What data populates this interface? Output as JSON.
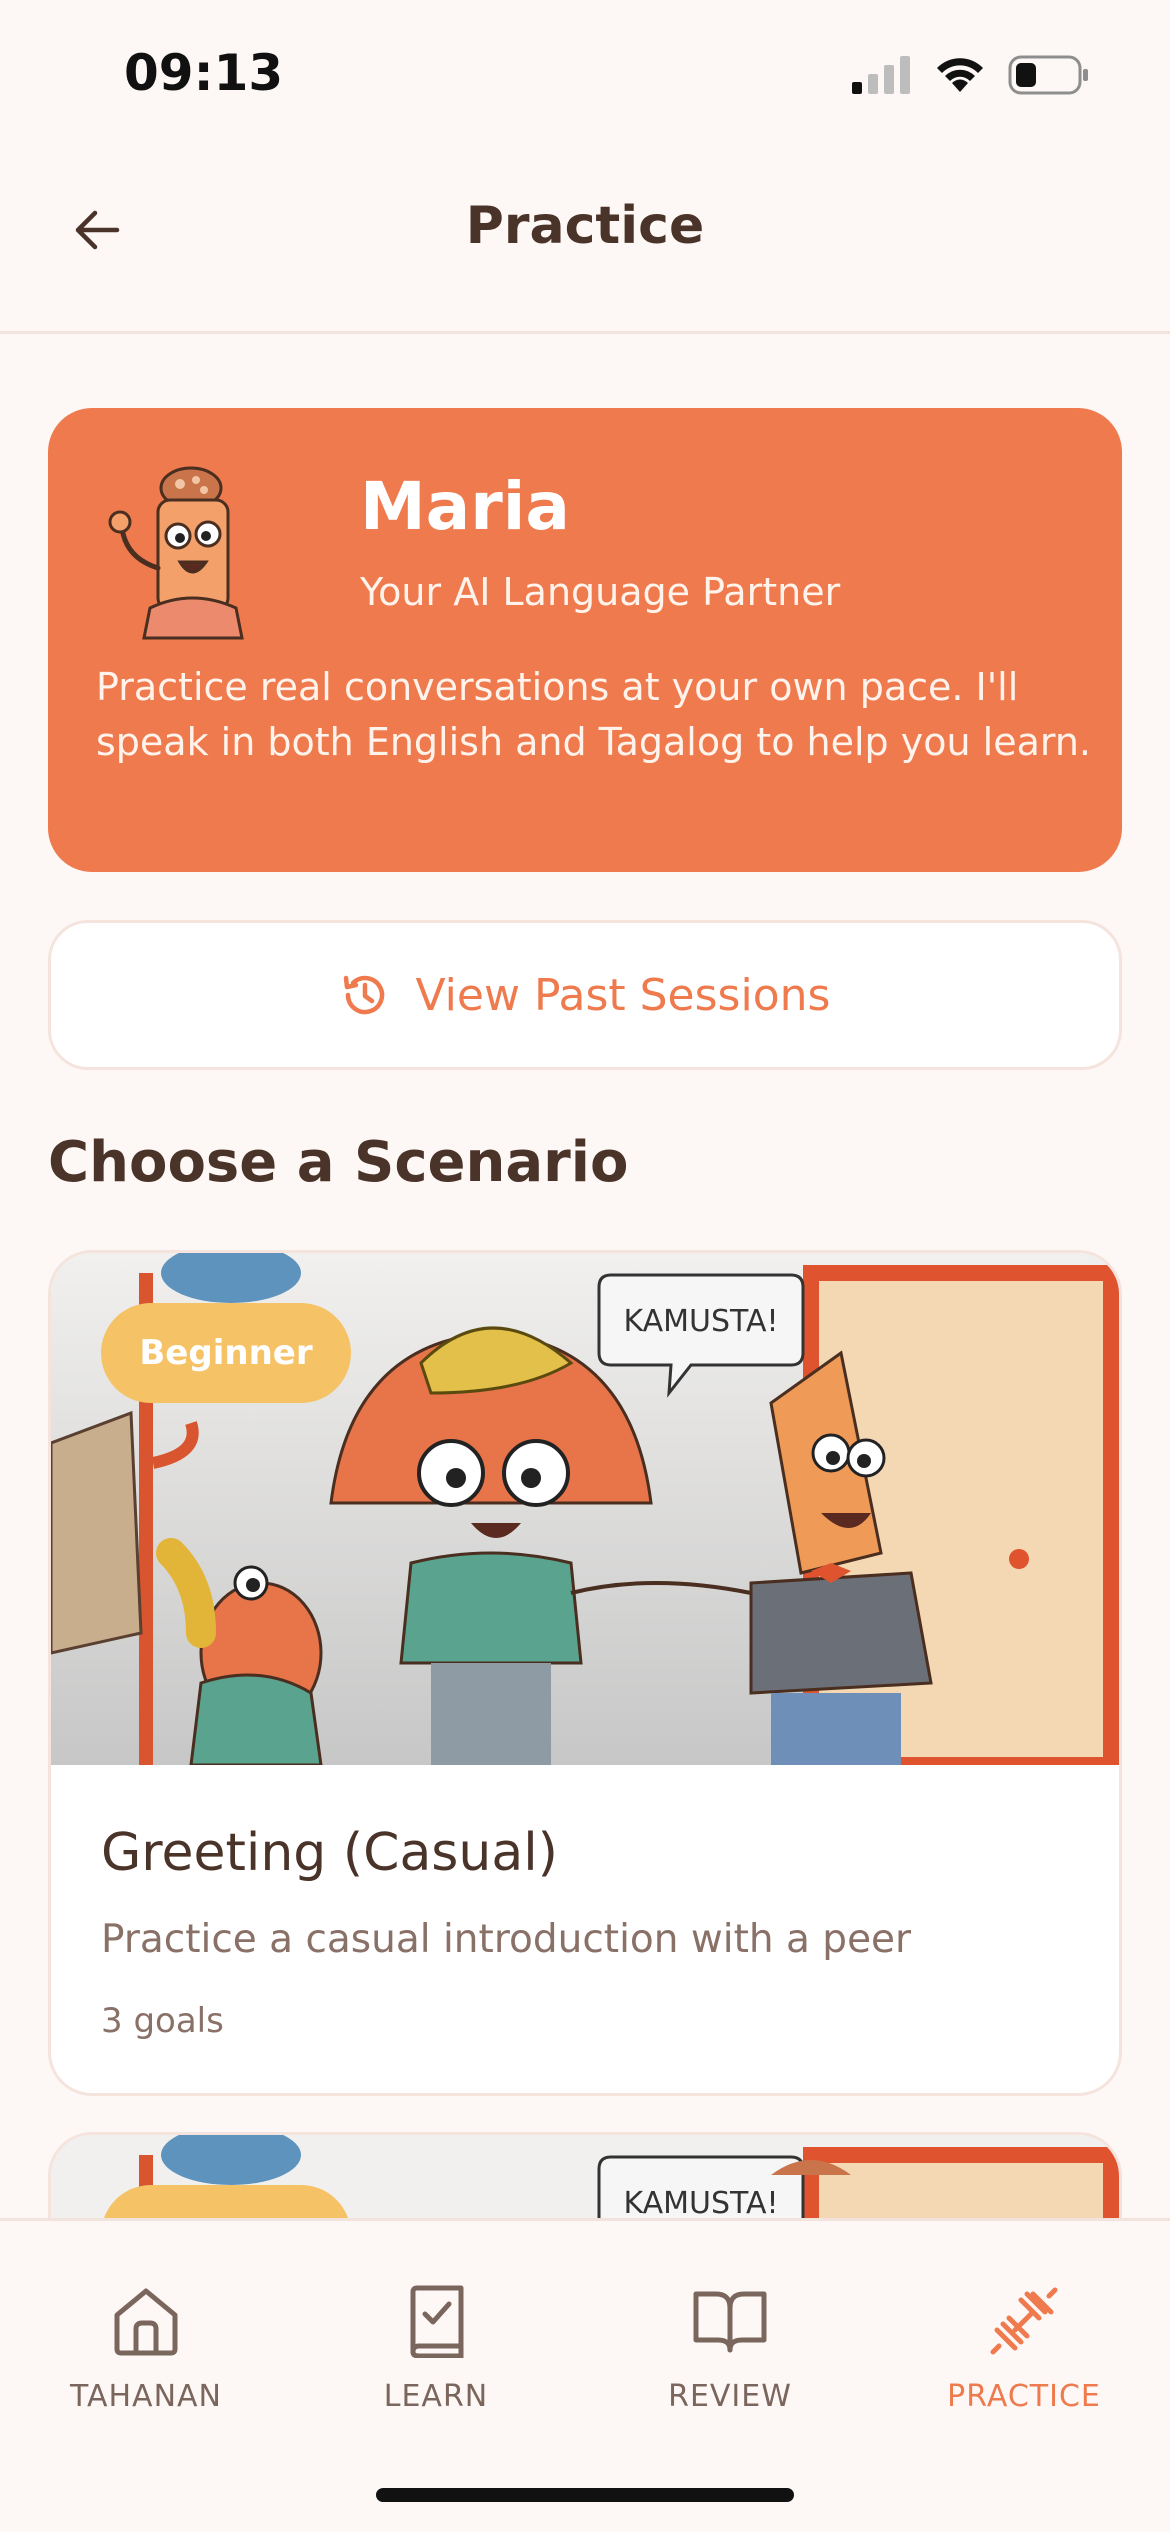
{
  "status_bar": {
    "time": "09:13"
  },
  "header": {
    "title": "Practice"
  },
  "partner": {
    "name": "Maria",
    "role": "Your AI Language Partner",
    "description": "Practice real conversations at your own pace. I'll speak in both English and Tagalog to help you learn."
  },
  "past_sessions": {
    "label": "View Past Sessions"
  },
  "section": {
    "title": "Choose a Scenario"
  },
  "scenarios": [
    {
      "level": "Beginner",
      "speech_bubble": "KAMUSTA!",
      "title": "Greeting (Casual)",
      "description": "Practice a casual introduction with a peer",
      "goals": "3 goals"
    },
    {
      "speech_bubble": "KAMUSTA!"
    }
  ],
  "nav": [
    {
      "label": "TAHANAN",
      "icon": "home-icon",
      "active": false
    },
    {
      "label": "LEARN",
      "icon": "book-check-icon",
      "active": false
    },
    {
      "label": "REVIEW",
      "icon": "open-book-icon",
      "active": false
    },
    {
      "label": "PRACTICE",
      "icon": "dumbbell-icon",
      "active": true
    }
  ],
  "colors": {
    "accent": "#EF7A4E",
    "badge": "#F5C266",
    "text_dark": "#4A3329",
    "text_muted": "#8A7168",
    "background": "#FDF8F5"
  }
}
